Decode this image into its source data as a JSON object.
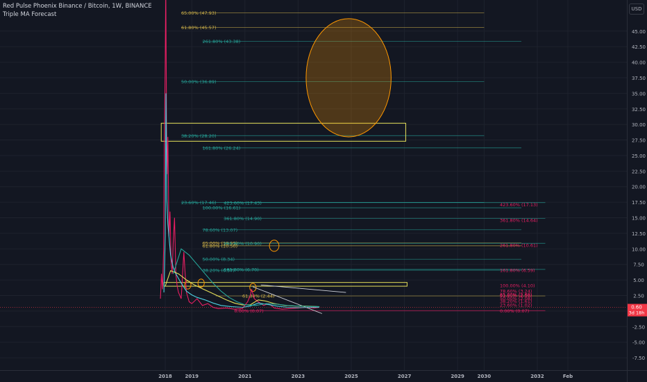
{
  "header": {
    "title": "Red Pulse Phoenix Binance / Bitcoin, 1W, BINANCE",
    "indicator": "Triple MA Forecast",
    "currency_button": "USD"
  },
  "colors": {
    "background": "#131722",
    "grid": "#1e222d",
    "teal": "#26a69a",
    "cyan": "#4dd0e1",
    "gold": "#d4b64a",
    "yellow": "#e6e05a",
    "pink": "#e91e63",
    "orange": "#ff9800",
    "white": "#d1d4dc",
    "price_line": "#f23645",
    "price_tag": "#f23645"
  },
  "chart_data": {
    "type": "line",
    "title": "Red Pulse Phoenix Binance / Bitcoin",
    "timeframe": "1W",
    "exchange": "BINANCE",
    "y_ticks": [
      "-7.50",
      "-5.00",
      "-2.50",
      "0.00",
      "2.50",
      "5.00",
      "7.50",
      "10.00",
      "12.50",
      "15.00",
      "17.50",
      "20.00",
      "22.50",
      "25.00",
      "27.50",
      "30.00",
      "32.50",
      "35.00",
      "37.50",
      "40.00",
      "42.50",
      "45.00"
    ],
    "y_range": [
      -9.5,
      50
    ],
    "x_ticks": [
      {
        "label": "2018",
        "t": 2018.0
      },
      {
        "label": "2019",
        "t": 2019.0
      },
      {
        "label": "2021",
        "t": 2021.0
      },
      {
        "label": "2023",
        "t": 2023.0
      },
      {
        "label": "2025",
        "t": 2025.0
      },
      {
        "label": "2027",
        "t": 2027.0
      },
      {
        "label": "2029",
        "t": 2029.0
      },
      {
        "label": "2030",
        "t": 2030.0
      },
      {
        "label": "2032",
        "t": 2032.0
      },
      {
        "label": "Feb",
        "t": 2033.15
      }
    ],
    "last_price": "0.60",
    "price_tag_time": "3d 18h",
    "fib_levels": [
      {
        "label": "65.00% (47.93)",
        "y": 47.93,
        "t0": 2018.6,
        "t1": 2030.0,
        "color": "gold",
        "label_t": 2018.6
      },
      {
        "label": "61.80% (45.57)",
        "y": 45.57,
        "t0": 2018.6,
        "t1": 2030.0,
        "color": "gold",
        "label_t": 2018.6
      },
      {
        "label": "261.80% (43.38)",
        "y": 43.38,
        "t0": 2019.4,
        "t1": 2031.4,
        "color": "teal",
        "label_t": 2019.4
      },
      {
        "label": "50.00% (36.89)",
        "y": 36.89,
        "t0": 2018.6,
        "t1": 2030.0,
        "color": "teal",
        "label_t": 2018.6
      },
      {
        "label": "38.20% (28.20)",
        "y": 28.2,
        "t0": 2018.6,
        "t1": 2030.0,
        "color": "teal",
        "label_t": 2018.6
      },
      {
        "label": "161.80% (26.24)",
        "y": 26.24,
        "t0": 2019.4,
        "t1": 2031.4,
        "color": "teal",
        "label_t": 2019.4
      },
      {
        "label": "23.60% (17.46)",
        "y": 17.46,
        "t0": 2018.6,
        "t1": 2030.0,
        "color": "teal",
        "label_t": 2018.6
      },
      {
        "label": "423.60% (17.43)",
        "y": 17.43,
        "t0": 2020.2,
        "t1": 2032.3,
        "color": "teal",
        "label_t": 2020.2
      },
      {
        "label": "100.00% (16.61)",
        "y": 16.61,
        "t0": 2019.4,
        "t1": 2031.4,
        "color": "teal",
        "label_t": 2019.4
      },
      {
        "label": "361.80% (14.90)",
        "y": 14.9,
        "t0": 2020.2,
        "t1": 2032.3,
        "color": "teal",
        "label_t": 2020.2
      },
      {
        "label": "78.60% (13.07)",
        "y": 13.07,
        "t0": 2019.4,
        "t1": 2031.4,
        "color": "teal",
        "label_t": 2019.4
      },
      {
        "label": "65.00% (10.95)",
        "y": 10.95,
        "t0": 2019.4,
        "t1": 2031.4,
        "color": "gold",
        "label_t": 2019.4
      },
      {
        "label": "261.80% (10.90)",
        "y": 10.9,
        "t0": 2020.2,
        "t1": 2032.3,
        "color": "teal",
        "label_t": 2020.2
      },
      {
        "label": "61.80% (10.50)",
        "y": 10.5,
        "t0": 2019.4,
        "t1": 2031.4,
        "color": "gold",
        "label_t": 2019.4
      },
      {
        "label": "50.00% (8.34)",
        "y": 8.34,
        "t0": 2019.4,
        "t1": 2031.4,
        "color": "teal",
        "label_t": 2019.4
      },
      {
        "label": "161.80% (6.70)",
        "y": 6.7,
        "t0": 2020.2,
        "t1": 2032.3,
        "color": "teal",
        "label_t": 2020.2
      },
      {
        "label": "38.20% (6.57)",
        "y": 6.57,
        "t0": 2019.4,
        "t1": 2031.4,
        "color": "teal",
        "label_t": 2019.4
      },
      {
        "label": "61.80% (2.44)",
        "y": 2.44,
        "t0": 2019.9,
        "t1": 2032.3,
        "color": "gold",
        "label_t": 2020.9
      },
      {
        "label": "0.00% (0.07)",
        "y": 0.07,
        "t0": 2020.6,
        "t1": 2032.3,
        "color": "pink",
        "label_t": 2020.6
      }
    ],
    "right_labels": [
      {
        "label": "423.60% (17.13)",
        "y": 17.13
      },
      {
        "label": "361.80% (14.64)",
        "y": 14.64
      },
      {
        "label": "261.80% (10.61)",
        "y": 10.61
      },
      {
        "label": "161.80% (6.59)",
        "y": 6.59
      },
      {
        "label": "100.00% (4.10)",
        "y": 4.1
      },
      {
        "label": "78.60% (3.24)",
        "y": 3.24
      },
      {
        "label": "65.00% (2.69)",
        "y": 2.69
      },
      {
        "label": "61.80% (2.56)",
        "y": 2.56
      },
      {
        "label": "50.00% (2.08)",
        "y": 2.08
      },
      {
        "label": "38.20% (1.61)",
        "y": 1.61
      },
      {
        "label": "23.60% (1.02)",
        "y": 1.02
      },
      {
        "label": "0.00% (0.07)",
        "y": 0.07
      }
    ],
    "rectangles": [
      {
        "t0": 2017.85,
        "t1": 2027.05,
        "y0": 27.3,
        "y1": 30.2,
        "color": "yellow"
      },
      {
        "t0": 2017.95,
        "t1": 2027.1,
        "y0": 4.0,
        "y1": 4.6,
        "color": "yellow"
      }
    ],
    "ellipses": [
      {
        "t": 2024.9,
        "y": 37.5,
        "rt": 1.6,
        "ry": 9.5,
        "color": "orange",
        "fill": true
      },
      {
        "t": 2022.1,
        "y": 10.5,
        "rt": 0.18,
        "ry": 0.9,
        "color": "orange",
        "fill": false
      },
      {
        "t": 2018.85,
        "y": 4.2,
        "rt": 0.12,
        "ry": 0.65,
        "color": "orange",
        "fill": false
      },
      {
        "t": 2019.35,
        "y": 4.5,
        "rt": 0.12,
        "ry": 0.65,
        "color": "orange",
        "fill": false
      },
      {
        "t": 2021.3,
        "y": 3.8,
        "rt": 0.12,
        "ry": 0.65,
        "color": "orange",
        "fill": false
      }
    ],
    "trend_lines": [
      {
        "t0": 2021.3,
        "y0": 3.9,
        "t1": 2023.9,
        "y1": -0.4,
        "color": "white"
      },
      {
        "t0": 2021.6,
        "y0": 4.2,
        "t1": 2024.8,
        "y1": 3.0,
        "color": "white"
      }
    ],
    "series": [
      {
        "color": "pink",
        "points": [
          [
            2017.82,
            2.0
          ],
          [
            2017.86,
            6.0
          ],
          [
            2017.9,
            3.5
          ],
          [
            2017.94,
            10.0
          ],
          [
            2017.97,
            28.0
          ],
          [
            2018.0,
            40.0
          ],
          [
            2018.02,
            52.0
          ],
          [
            2018.05,
            30.0
          ],
          [
            2018.07,
            22.0
          ],
          [
            2018.1,
            28.0
          ],
          [
            2018.14,
            12.0
          ],
          [
            2018.18,
            16.0
          ],
          [
            2018.22,
            8.0
          ],
          [
            2018.26,
            6.0
          ],
          [
            2018.3,
            11.0
          ],
          [
            2018.35,
            15.0
          ],
          [
            2018.4,
            6.0
          ],
          [
            2018.45,
            4.0
          ],
          [
            2018.5,
            3.0
          ],
          [
            2018.6,
            2.0
          ],
          [
            2018.7,
            9.5
          ],
          [
            2018.75,
            6.0
          ],
          [
            2018.8,
            3.0
          ],
          [
            2018.9,
            1.5
          ],
          [
            2019.0,
            1.2
          ],
          [
            2019.2,
            2.0
          ],
          [
            2019.4,
            0.9
          ],
          [
            2019.6,
            1.2
          ],
          [
            2019.8,
            0.6
          ],
          [
            2020.0,
            0.4
          ],
          [
            2020.3,
            0.5
          ],
          [
            2020.6,
            0.3
          ],
          [
            2020.9,
            0.4
          ],
          [
            2021.1,
            1.5
          ],
          [
            2021.2,
            2.5
          ],
          [
            2021.25,
            3.5
          ],
          [
            2021.35,
            2.0
          ],
          [
            2021.5,
            1.5
          ],
          [
            2021.7,
            0.9
          ],
          [
            2021.9,
            1.2
          ],
          [
            2022.1,
            0.5
          ],
          [
            2022.4,
            0.3
          ],
          [
            2022.7,
            0.4
          ],
          [
            2023.0,
            0.5
          ],
          [
            2023.3,
            0.6
          ],
          [
            2023.6,
            0.5
          ],
          [
            2023.8,
            0.6
          ]
        ]
      },
      {
        "color": "cyan",
        "points": [
          [
            2017.95,
            3.0
          ],
          [
            2018.0,
            12.0
          ],
          [
            2018.03,
            35.0
          ],
          [
            2018.06,
            18.0
          ],
          [
            2018.1,
            14.0
          ],
          [
            2018.2,
            9.0
          ],
          [
            2018.3,
            7.0
          ],
          [
            2018.4,
            6.0
          ],
          [
            2018.6,
            4.5
          ],
          [
            2018.8,
            3.2
          ],
          [
            2019.0,
            2.6
          ],
          [
            2019.2,
            2.2
          ],
          [
            2019.5,
            1.8
          ],
          [
            2019.8,
            1.3
          ],
          [
            2020.1,
            0.9
          ],
          [
            2020.5,
            0.7
          ],
          [
            2020.9,
            0.6
          ],
          [
            2021.2,
            0.8
          ],
          [
            2021.5,
            1.3
          ],
          [
            2021.8,
            1.1
          ],
          [
            2022.2,
            0.8
          ],
          [
            2022.6,
            0.6
          ],
          [
            2023.0,
            0.55
          ],
          [
            2023.4,
            0.6
          ],
          [
            2023.8,
            0.6
          ]
        ]
      },
      {
        "color": "yellow",
        "points": [
          [
            2018.0,
            4.0
          ],
          [
            2018.2,
            6.5
          ],
          [
            2018.5,
            6.0
          ],
          [
            2018.8,
            5.0
          ],
          [
            2019.1,
            4.2
          ],
          [
            2019.4,
            3.6
          ],
          [
            2019.7,
            3.0
          ],
          [
            2020.0,
            2.4
          ],
          [
            2020.3,
            1.8
          ],
          [
            2020.6,
            1.3
          ],
          [
            2020.9,
            1.0
          ],
          [
            2021.2,
            1.0
          ],
          [
            2021.5,
            1.8
          ],
          [
            2021.8,
            1.6
          ],
          [
            2022.1,
            1.2
          ],
          [
            2022.5,
            0.9
          ],
          [
            2022.9,
            0.8
          ],
          [
            2023.3,
            0.8
          ],
          [
            2023.8,
            0.7
          ]
        ]
      },
      {
        "color": "teal",
        "points": [
          [
            2018.3,
            6.0
          ],
          [
            2018.6,
            10.0
          ],
          [
            2018.9,
            9.0
          ],
          [
            2019.2,
            7.5
          ],
          [
            2019.5,
            6.0
          ],
          [
            2019.8,
            4.5
          ],
          [
            2020.1,
            3.2
          ],
          [
            2020.4,
            2.2
          ],
          [
            2020.7,
            1.5
          ],
          [
            2021.0,
            1.0
          ],
          [
            2021.4,
            0.9
          ],
          [
            2021.8,
            1.2
          ],
          [
            2022.2,
            1.1
          ],
          [
            2022.6,
            0.9
          ],
          [
            2023.0,
            0.8
          ],
          [
            2023.4,
            0.75
          ],
          [
            2023.8,
            0.7
          ]
        ]
      }
    ]
  }
}
